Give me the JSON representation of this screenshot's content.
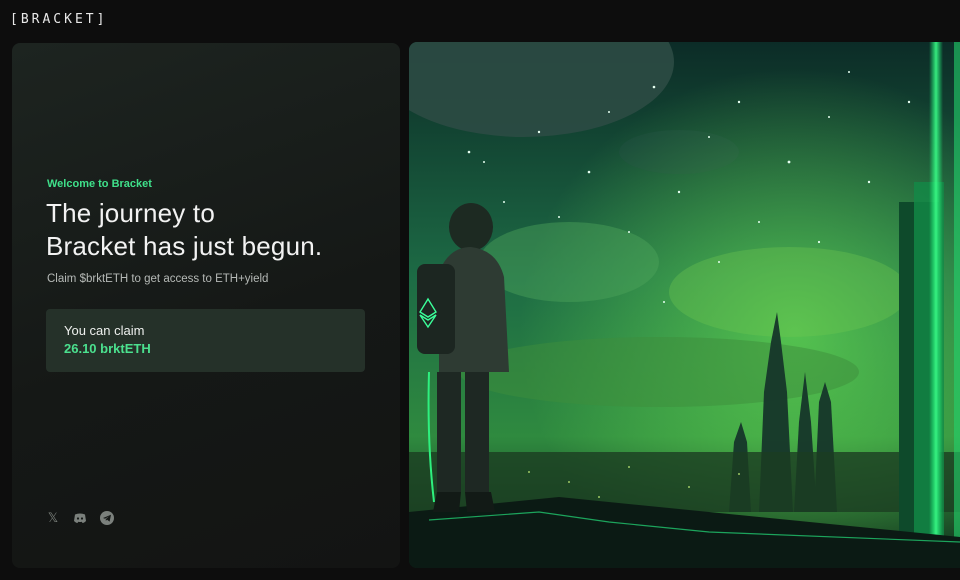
{
  "header": {
    "logo_text": "[BRACKET]"
  },
  "welcome": {
    "eyebrow": "Welcome to Bracket",
    "headline_line1": "The journey to",
    "headline_line2": "Bracket has just begun.",
    "subtitle": "Claim $brktETH to get access to ETH+yield"
  },
  "claim": {
    "label": "You can claim",
    "amount": "26.10 brktETH"
  },
  "socials": [
    {
      "name": "x-icon",
      "glyph": "𝕏"
    },
    {
      "name": "discord-icon",
      "glyph": "◉"
    },
    {
      "name": "telegram-icon",
      "glyph": "➤"
    }
  ],
  "colors": {
    "accent": "#3fe08a",
    "panel_bg": "#151816",
    "card_bg": "#253129",
    "page_bg": "#0d0d0d"
  },
  "hero_image": {
    "icon": "ethereum-icon"
  }
}
